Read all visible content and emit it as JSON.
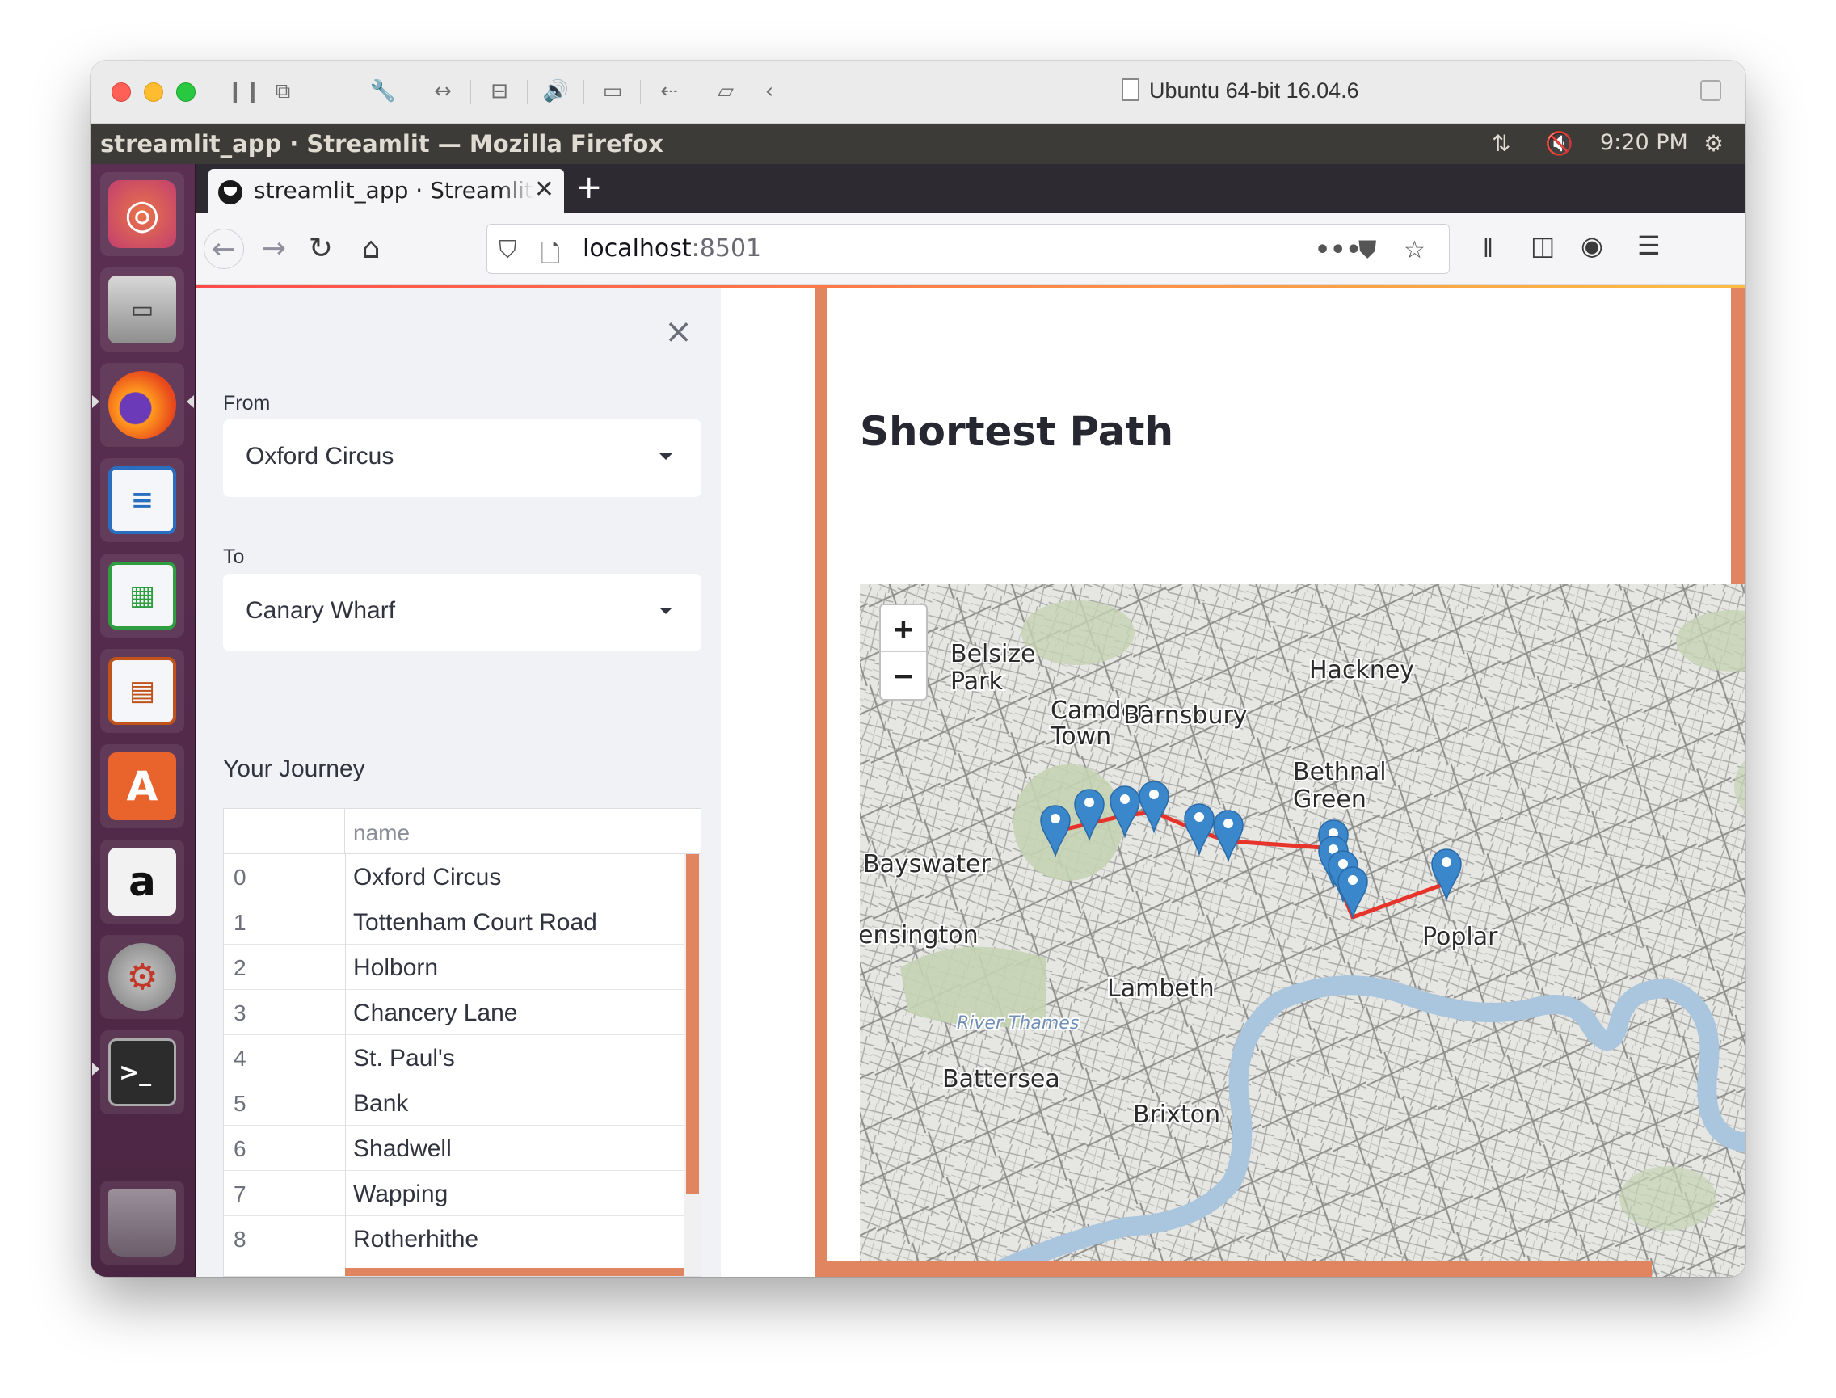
{
  "host_window": {
    "title": "Ubuntu 64-bit 16.04.6"
  },
  "ubuntu_panel": {
    "window_title": "streamlit_app · Streamlit — Mozilla Firefox",
    "time": "9:20 PM"
  },
  "launcher": {
    "items": [
      "ubuntu-dash",
      "files",
      "firefox",
      "writer",
      "calc",
      "impress",
      "software-center",
      "amazon",
      "system-settings",
      "terminal",
      "trash"
    ]
  },
  "browser": {
    "tab_label": "streamlit_app · Streamlit",
    "url_host": "localhost",
    "url_port": ":8501"
  },
  "sidebar": {
    "from_label": "From",
    "from_value": "Oxford Circus",
    "to_label": "To",
    "to_value": "Canary Wharf",
    "journey_heading": "Your Journey",
    "table": {
      "column": "name",
      "rows": [
        {
          "index": "0",
          "name": "Oxford Circus"
        },
        {
          "index": "1",
          "name": "Tottenham Court Road"
        },
        {
          "index": "2",
          "name": "Holborn"
        },
        {
          "index": "3",
          "name": "Chancery Lane"
        },
        {
          "index": "4",
          "name": "St. Paul's"
        },
        {
          "index": "5",
          "name": "Bank"
        },
        {
          "index": "6",
          "name": "Shadwell"
        },
        {
          "index": "7",
          "name": "Wapping"
        },
        {
          "index": "8",
          "name": "Rotherhithe"
        }
      ]
    }
  },
  "main": {
    "title": "Shortest Path",
    "map": {
      "zoom_in": "+",
      "zoom_out": "−",
      "labels": [
        "Belsize Park",
        "Camden Town",
        "Barnsbury",
        "Hackney",
        "Bethnal Green",
        "Bayswater",
        "ensington",
        "Poplar",
        "Lambeth",
        "River Thames",
        "Battersea",
        "Brixton"
      ],
      "route_color": "#e8332a",
      "marker_color": "#3a87cc",
      "river_color": "#a9c6de"
    }
  }
}
